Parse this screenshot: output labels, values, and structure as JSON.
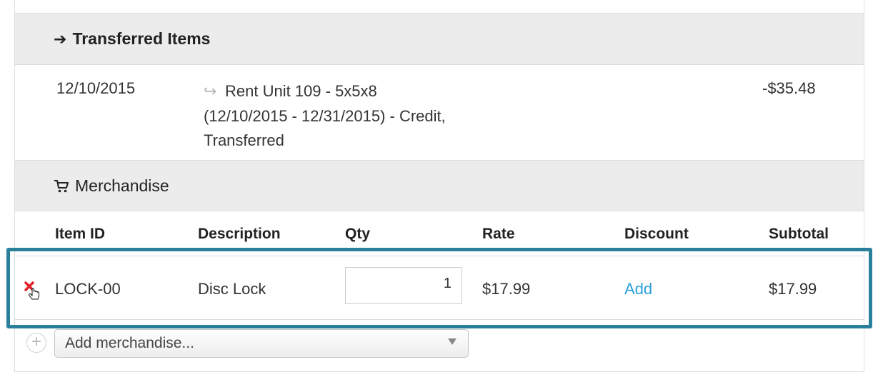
{
  "transferred": {
    "title": "Transferred Items",
    "rows": [
      {
        "date": "12/10/2015",
        "desc_line1": "Rent Unit 109 - 5x5x8",
        "desc_line2": "(12/10/2015 - 12/31/2015) - Credit,",
        "desc_line3": "Transferred",
        "amount": "-$35.48"
      }
    ]
  },
  "merchandise": {
    "title": "Merchandise",
    "columns": {
      "item_id": "Item ID",
      "description": "Description",
      "qty": "Qty",
      "rate": "Rate",
      "discount": "Discount",
      "subtotal": "Subtotal"
    },
    "rows": [
      {
        "item_id": "LOCK-00",
        "description": "Disc Lock",
        "qty": "1",
        "rate": "$17.99",
        "discount_link": "Add",
        "subtotal": "$17.99"
      }
    ],
    "add_select_label": "Add merchandise..."
  },
  "colors": {
    "highlight": "#2a7f9b",
    "link": "#2aa0d8",
    "remove": "#e0222a",
    "header_bg": "#ececec"
  },
  "icons": {
    "section_transferred": "arrow-right-icon",
    "row_transferred": "return-arrow-icon",
    "section_merchandise": "shopping-cart-icon",
    "row_remove": "remove-x-icon",
    "add": "plus-circle-icon",
    "select": "chevron-down-icon"
  }
}
